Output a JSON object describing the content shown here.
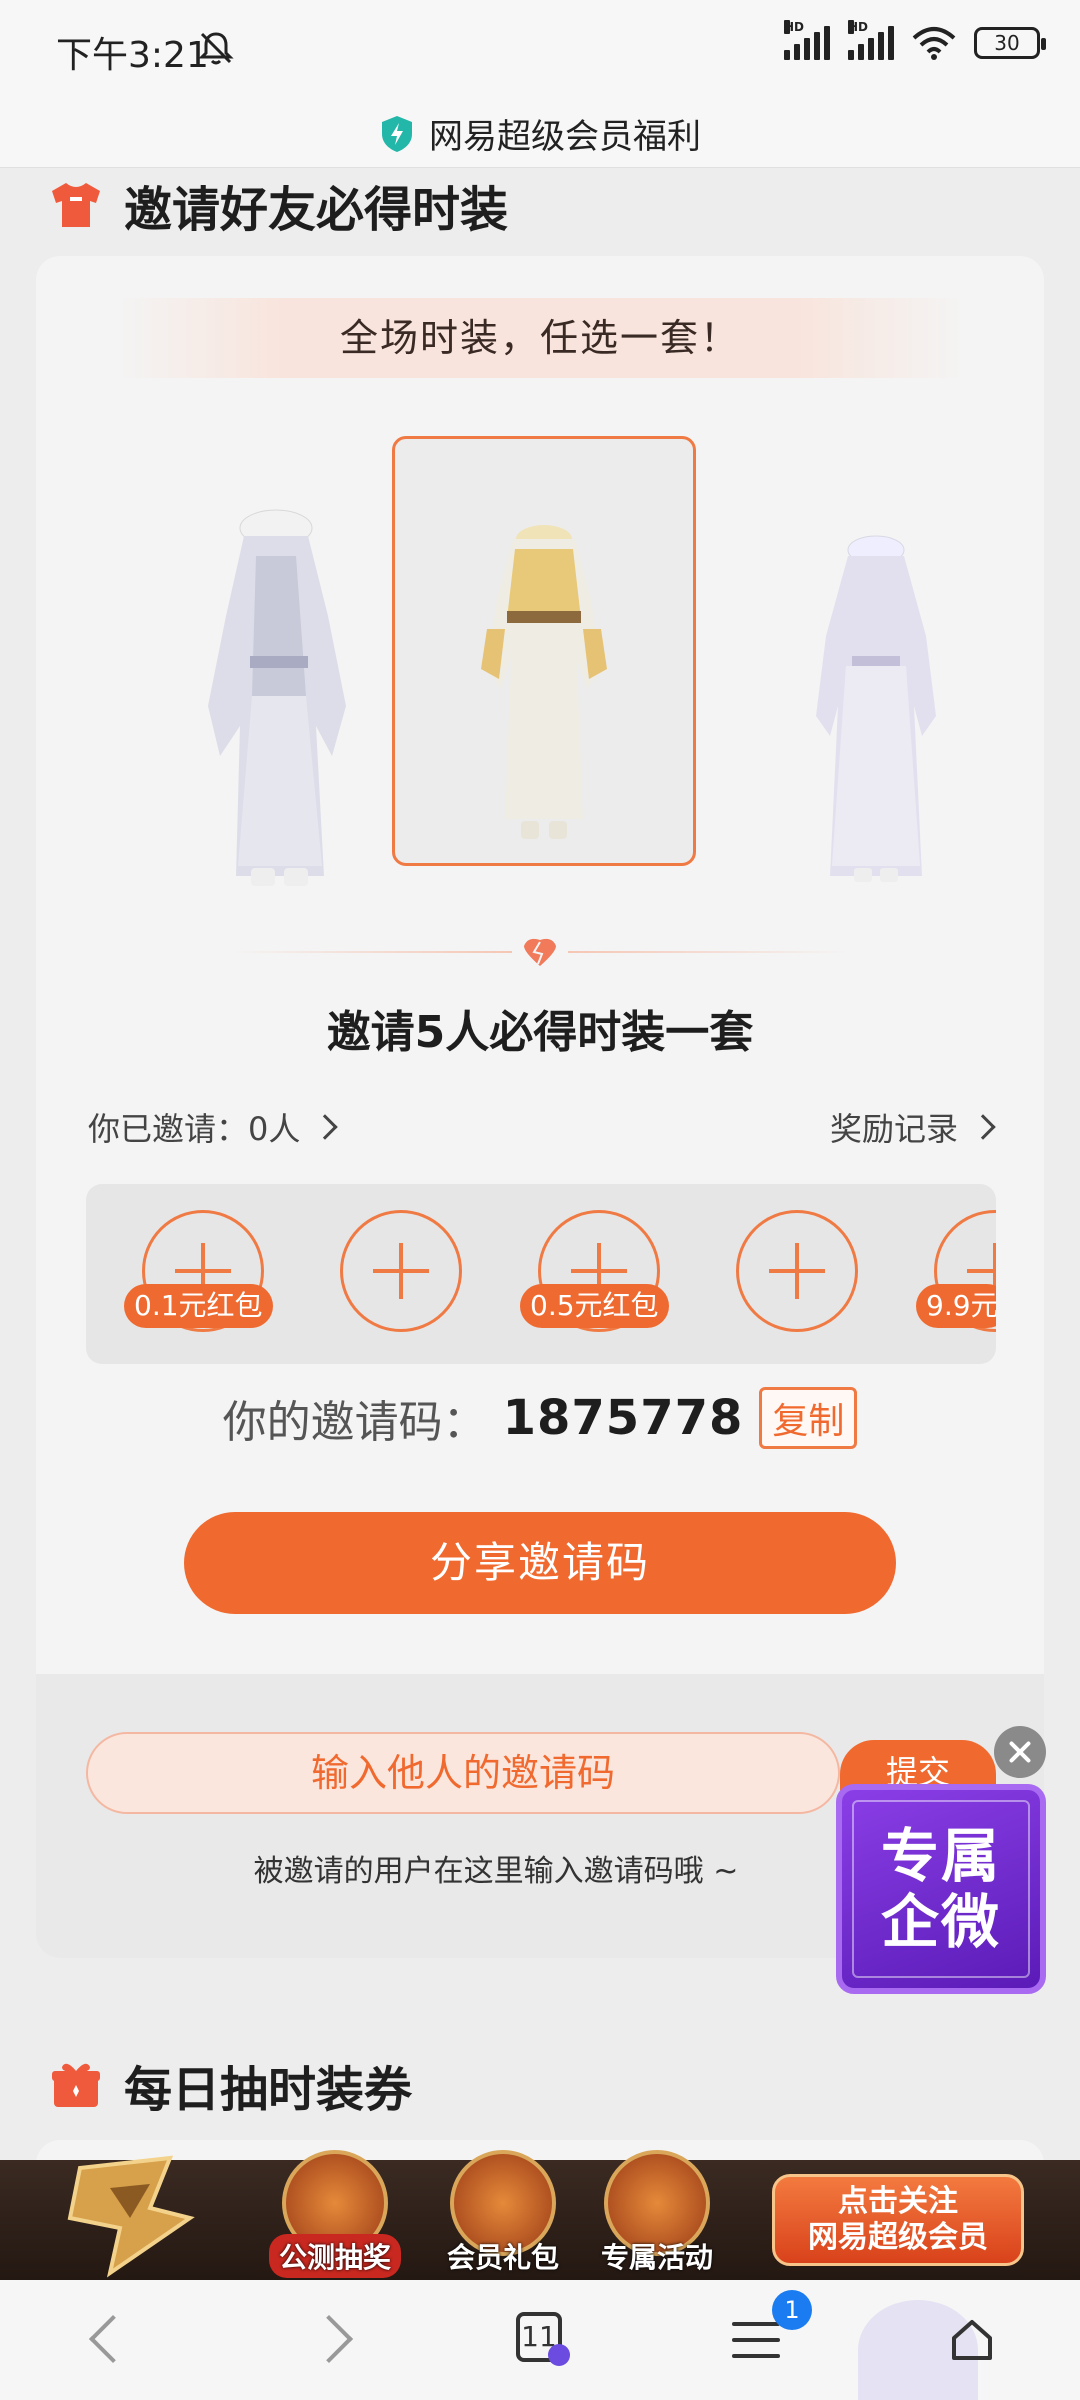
{
  "status_bar": {
    "time": "下午3:21",
    "battery": "30"
  },
  "title_bar": {
    "title": "网易超级会员福利"
  },
  "section1": {
    "title": "邀请好友必得时装"
  },
  "card": {
    "banner": "全场时装，任选一套！",
    "invite_title": "邀请5人必得时装一套",
    "invited_label": "你已邀请：0人",
    "record_label": "奖励记录",
    "slot_badges": [
      "0.1元红包",
      "0.5元红包",
      "9.9元"
    ],
    "code_label": "你的邀请码：",
    "code_value": "1875778",
    "copy_label": "复制",
    "share_label": "分享邀请码",
    "input_placeholder": "输入他人的邀请码",
    "submit_label": "提交",
    "hint": "被邀请的用户在这里输入邀请码哦 ~"
  },
  "float_widget": {
    "line1": "专属",
    "line2": "企微"
  },
  "section2": {
    "title": "每日抽时装券"
  },
  "promo": {
    "items": [
      "公测抽奖",
      "会员礼包",
      "专属活动"
    ],
    "cta_line1": "点击关注",
    "cta_line2": "网易超级会员"
  },
  "navbar": {
    "tab_count": "11",
    "menu_badge": "1"
  },
  "colors": {
    "accent": "#f06a30",
    "purple": "#6b2bd0",
    "teal": "#22b7a8"
  }
}
